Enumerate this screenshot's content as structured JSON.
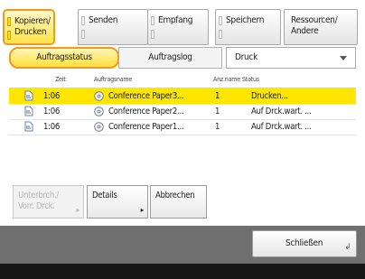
{
  "tabs": [
    {
      "line1": "Kopieren/",
      "line2": "Drucken",
      "active": true
    },
    {
      "line1": "Senden",
      "line2": "",
      "active": false
    },
    {
      "line1": "Empfang",
      "line2": "",
      "active": false
    },
    {
      "line1": "Speichern",
      "line2": "",
      "active": false
    },
    {
      "line1": "Ressourcen/",
      "line2": "Andere",
      "active": false
    }
  ],
  "subtabs": {
    "status": "Auftragsstatus",
    "log": "Auftragslog"
  },
  "dropdown": {
    "value": "Druck"
  },
  "columns": {
    "time": "Zeit",
    "name": "Auftragsname",
    "count": "Anz.name",
    "status": "Status"
  },
  "rows": [
    {
      "time": "1:06",
      "name": "Conference Paper3...",
      "count": "1",
      "status": "Drucken...",
      "selected": true
    },
    {
      "time": "1:06",
      "name": "Conference Paper2...",
      "count": "1",
      "status": "Auf Drck.wart. ...",
      "selected": false
    },
    {
      "time": "1:06",
      "name": "Conference Paper1...",
      "count": "1",
      "status": "Auf Drck.wart. ...",
      "selected": false
    }
  ],
  "buttons": {
    "interrupt_line1": "Unterbrch./",
    "interrupt_line2": "Vorr. Drck.",
    "details": "Details",
    "cancel": "Abbrechen",
    "close": "Schließen"
  },
  "colors": {
    "accent_orange": "#f29a1d",
    "selection_yellow": "#ffe600",
    "bar_gray": "#6f6f6f"
  },
  "icons": {
    "row_icon": "document-icon",
    "name_icon": "disc-icon",
    "close_corner": "return-corner-icon"
  }
}
